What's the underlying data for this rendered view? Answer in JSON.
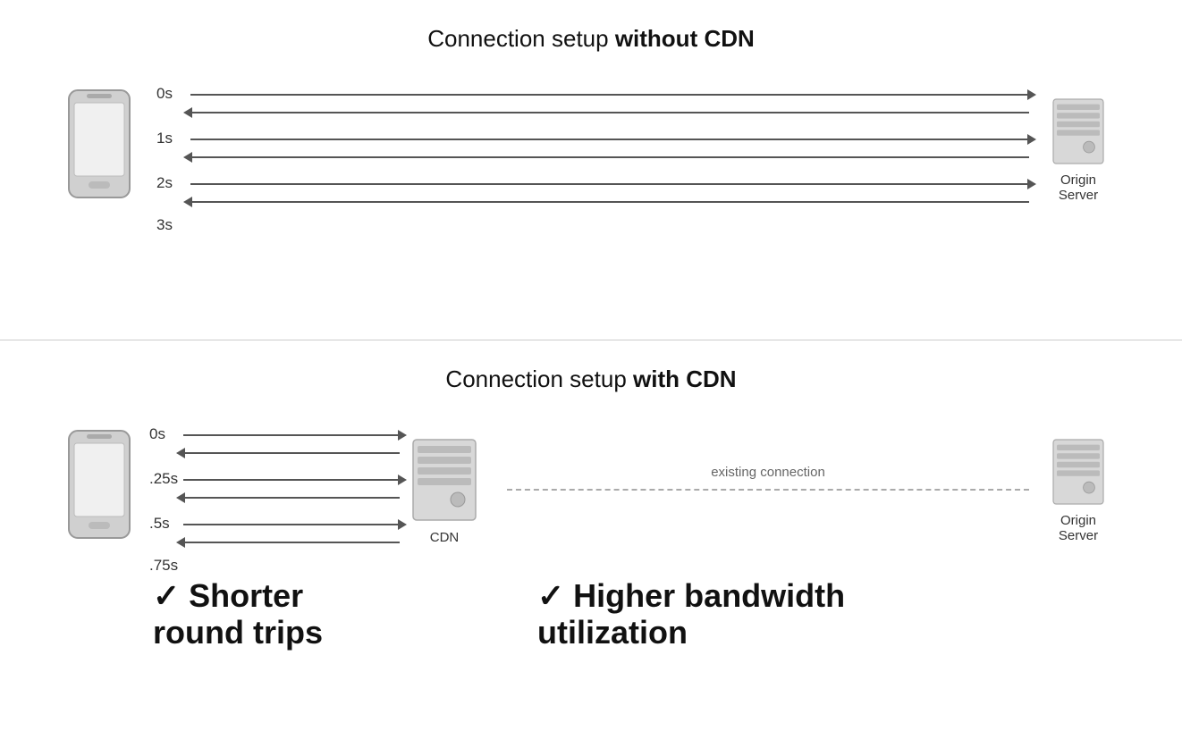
{
  "top": {
    "title_normal": "Connection setup ",
    "title_bold": "without CDN",
    "time_labels": [
      "0s",
      "1s",
      "2s",
      "3s"
    ],
    "origin_server_label": "Origin\nServer"
  },
  "bottom": {
    "title_normal": "Connection setup ",
    "title_bold": "with CDN",
    "time_labels": [
      "0s",
      ".25s",
      ".5s",
      ".75s"
    ],
    "cdn_label": "CDN",
    "existing_connection_label": "existing connection",
    "origin_server_label": "Origin\nServer",
    "benefit_left_check": "✓",
    "benefit_left_text": "Shorter\nround trips",
    "benefit_right_check": "✓",
    "benefit_right_text": "Higher bandwidth\nutilization"
  }
}
